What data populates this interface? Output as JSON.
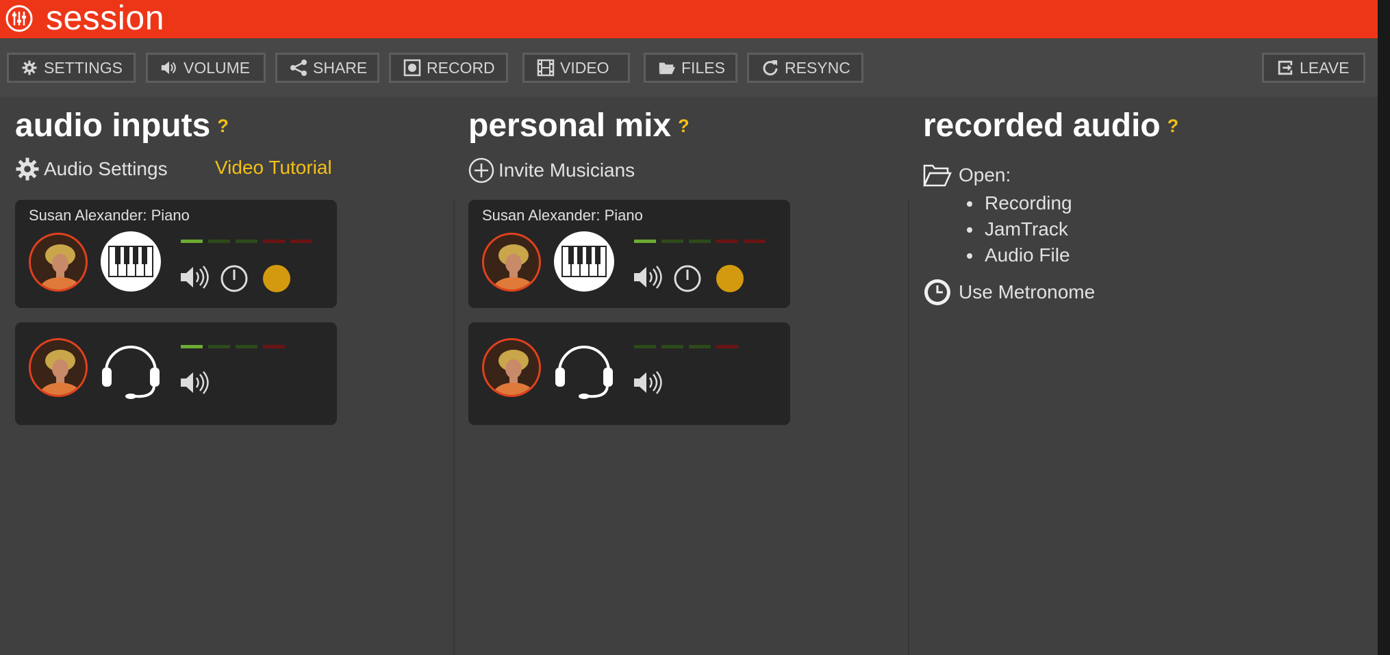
{
  "header": {
    "title": "session",
    "logo_icon": "mixer-sliders-icon",
    "color": "#ed3618"
  },
  "toolbar": {
    "buttons": [
      {
        "label": "SETTINGS",
        "icon": "gear-icon"
      },
      {
        "label": "VOLUME",
        "icon": "speaker-icon"
      },
      {
        "label": "SHARE",
        "icon": "share-icon"
      },
      {
        "label": "RECORD",
        "icon": "record-icon"
      },
      {
        "label": "VIDEO",
        "icon": "film-icon"
      },
      {
        "label": "FILES",
        "icon": "folder-open-icon"
      },
      {
        "label": "RESYNC",
        "icon": "refresh-icon"
      }
    ],
    "leave": {
      "label": "LEAVE",
      "icon": "exit-icon"
    }
  },
  "audio_inputs": {
    "title": "audio inputs",
    "help": "?",
    "audio_settings_label": "Audio Settings",
    "video_tutorial_label": "Video Tutorial",
    "tracks": [
      {
        "name": "Susan Alexander: Piano",
        "instrument": "piano-icon",
        "meter_segments": [
          "#6cab32",
          "#2c4a1a",
          "#2c4a1a",
          "#6b1414",
          "#6b1414"
        ],
        "has_pan": true,
        "has_solo": true
      },
      {
        "name": "",
        "instrument": "headset-icon",
        "meter_segments": [
          "#6cab32",
          "#2c4a1a",
          "#2c4a1a",
          "#6b1414"
        ],
        "has_pan": false,
        "has_solo": false
      }
    ]
  },
  "personal_mix": {
    "title": "personal mix",
    "help": "?",
    "invite_label": "Invite Musicians",
    "tracks": [
      {
        "name": "Susan Alexander: Piano",
        "instrument": "piano-icon",
        "meter_segments": [
          "#6cab32",
          "#2c4a1a",
          "#2c4a1a",
          "#6b1414",
          "#6b1414"
        ],
        "has_pan": true,
        "has_solo": true
      },
      {
        "name": "",
        "instrument": "headset-icon",
        "meter_segments": [
          "#2c4a1a",
          "#2c4a1a",
          "#2c4a1a",
          "#6b1414"
        ],
        "has_pan": false,
        "has_solo": false
      }
    ]
  },
  "recorded_audio": {
    "title": "recorded audio",
    "help": "?",
    "open_label": "Open:",
    "open_items": [
      "Recording",
      "JamTrack",
      "Audio File"
    ],
    "metronome_label": "Use Metronome"
  },
  "colors": {
    "accent": "#f2c017",
    "solo": "#d49a0f",
    "avatar_ring": "#e2411e"
  }
}
